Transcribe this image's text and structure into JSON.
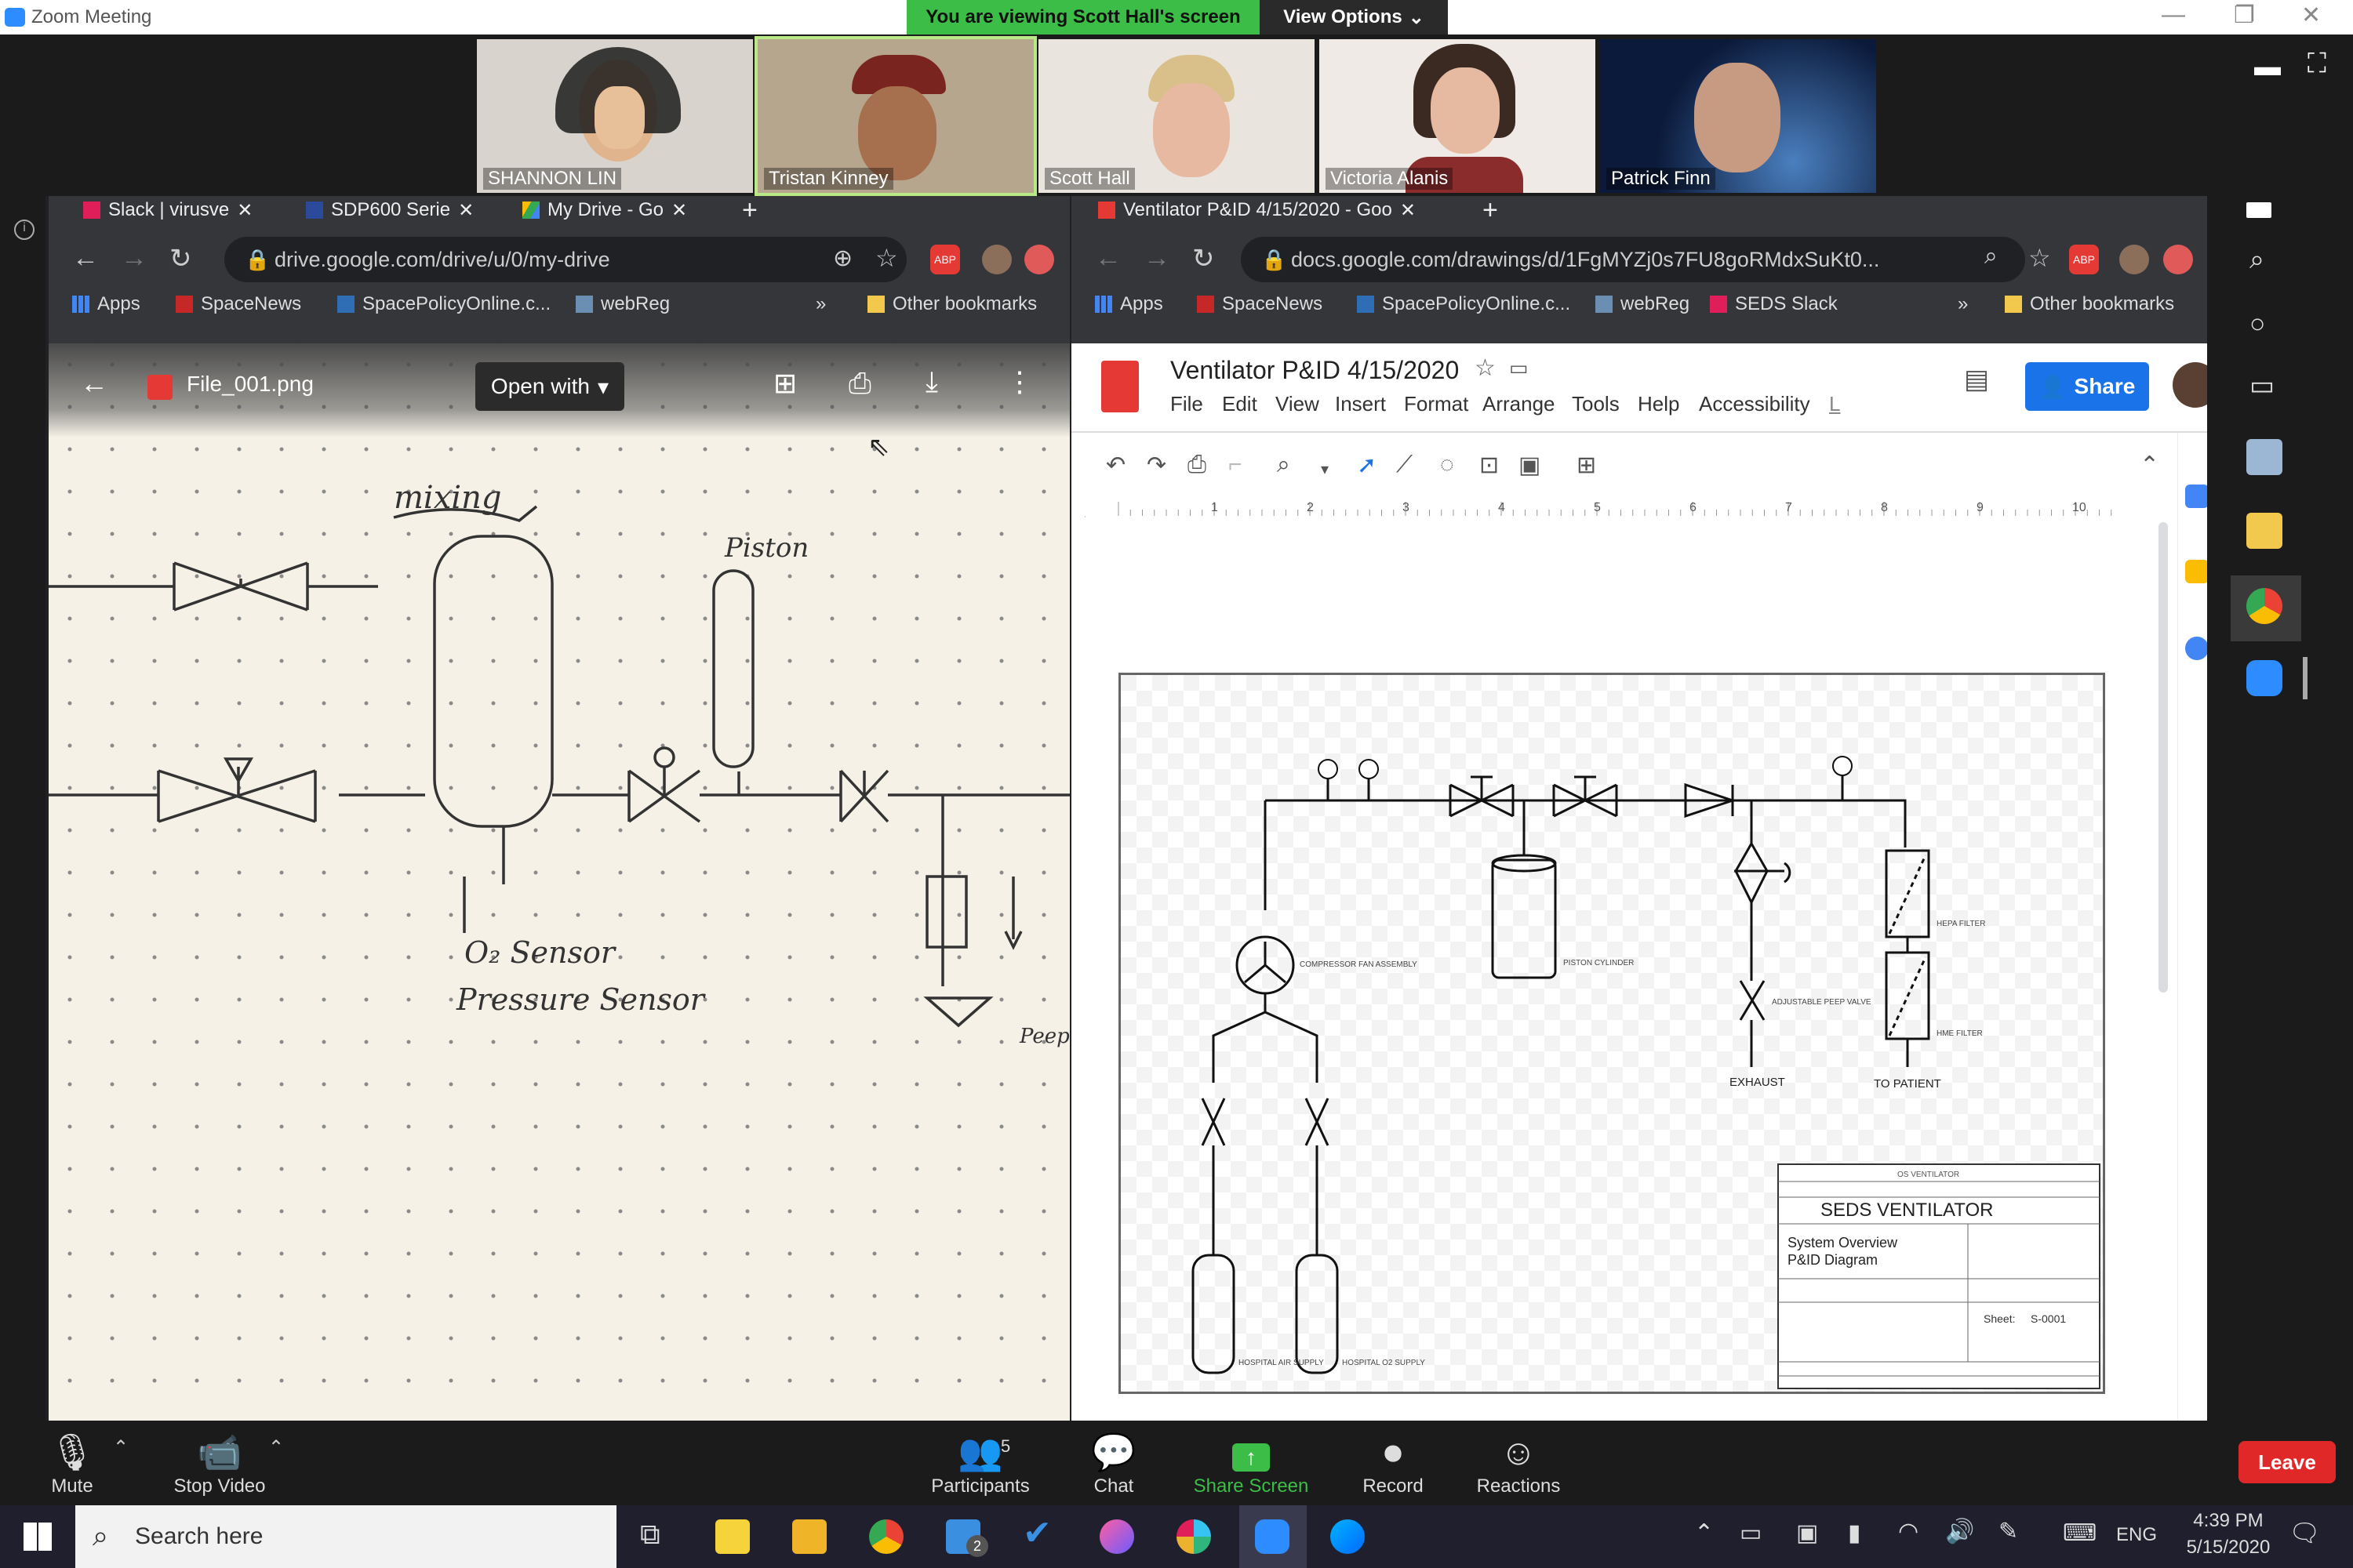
{
  "window": {
    "title": "Zoom Meeting"
  },
  "banner": {
    "viewing": "You are viewing Scott Hall's screen",
    "view_options": "View Options"
  },
  "participants_gallery": [
    {
      "name": "SHANNON LIN"
    },
    {
      "name": "Tristan Kinney"
    },
    {
      "name": "Scott Hall"
    },
    {
      "name": "Victoria Alanis"
    },
    {
      "name": "Patrick Finn"
    }
  ],
  "left_browser": {
    "tabs": [
      {
        "label": "Slack | virusve"
      },
      {
        "label": "SDP600 Serie"
      },
      {
        "label": "My Drive - Go"
      }
    ],
    "url": "drive.google.com/drive/u/0/my-drive",
    "bookmarks": [
      "Apps",
      "SpaceNews",
      "SpacePolicyOnline.c...",
      "webReg"
    ],
    "overflow": "»",
    "other_bookmarks": "Other bookmarks",
    "file_name": "File_001.png",
    "open_with": "Open with",
    "sketch_labels": {
      "mixing": "mixing",
      "piston": "Piston",
      "o2": "O₂ Sensor",
      "pressure": "Pressure Sensor",
      "peep": "Peep"
    }
  },
  "right_browser": {
    "tab": "Ventilator P&ID 4/15/2020 - Goo",
    "url": "docs.google.com/drawings/d/1FgMYZj0s7FU8goRMdxSuKt0...",
    "bookmarks": [
      "Apps",
      "SpaceNews",
      "SpacePolicyOnline.c...",
      "webReg",
      "SEDS Slack"
    ],
    "overflow": "»",
    "other_bookmarks": "Other bookmarks",
    "doc_title": "Ventilator P&ID 4/15/2020",
    "menu": [
      "File",
      "Edit",
      "View",
      "Insert",
      "Format",
      "Arrange",
      "Tools",
      "Help",
      "Accessibility",
      "L"
    ],
    "share": "Share",
    "ruler": [
      "1",
      "2",
      "3",
      "4",
      "5",
      "6",
      "7",
      "8",
      "9",
      "10"
    ],
    "diagram": {
      "compressor": "COMPRESSOR FAN ASSEMBLY",
      "piston": "PISTON CYLINDER",
      "peep": "ADJUSTABLE PEEP VALVE",
      "exhaust": "EXHAUST",
      "to_patient": "TO PATIENT",
      "hepa": "HEPA FILTER",
      "hme": "HME FILTER",
      "air": "HOSPITAL AIR SUPPLY",
      "o2": "HOSPITAL O2 SUPPLY",
      "title_block": {
        "title": "SEDS VENTILATOR",
        "line1": "System Overview",
        "line2": "P&ID Diagram",
        "sheet_label": "Sheet:",
        "sheet": "S-0001",
        "header": "OS VENTILATOR"
      }
    }
  },
  "zoom_toolbar": {
    "mute": "Mute",
    "stop_video": "Stop Video",
    "participants": "Participants",
    "participants_count": "5",
    "chat": "Chat",
    "share_screen": "Share Screen",
    "record": "Record",
    "reactions": "Reactions",
    "leave": "Leave"
  },
  "taskbar": {
    "search_placeholder": "Search here",
    "mail_badge": "2",
    "lang": "ENG",
    "time": "4:39 PM",
    "date": "5/15/2020"
  },
  "colors": {
    "zoom_green": "#3cbd47",
    "leave_red": "#e02828",
    "share_blue": "#1a73e8"
  }
}
